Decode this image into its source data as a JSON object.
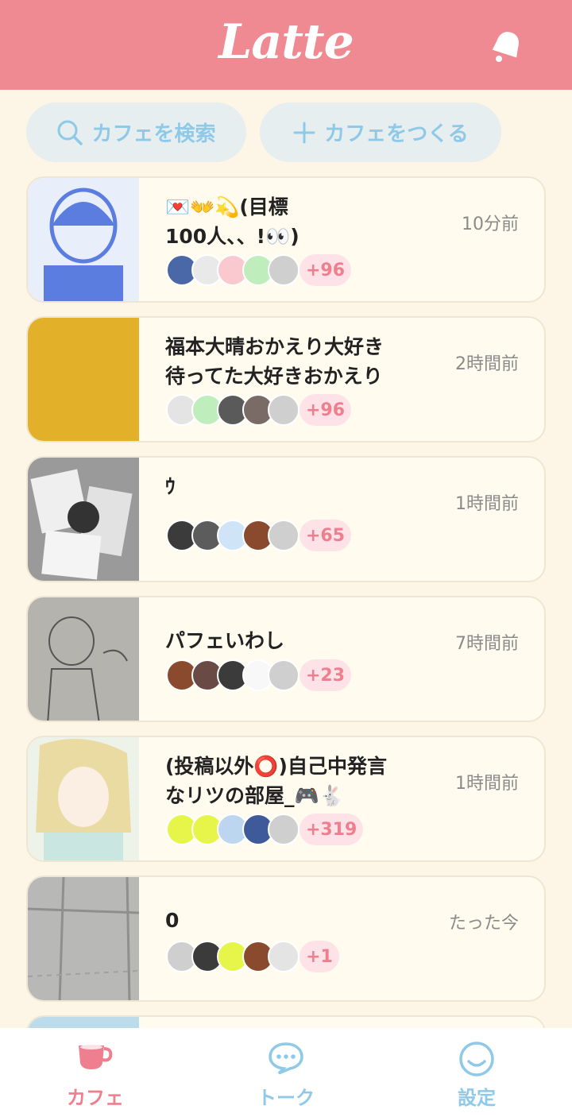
{
  "header": {
    "logo": "Latte",
    "bell_icon": "bell-icon"
  },
  "actions": {
    "search_label": "カフェを検索",
    "create_label": "カフェをつくる"
  },
  "cafes": [
    {
      "title": "💌👐💫(目標\n100人、、!👀)",
      "time": "10分前",
      "more": "+96",
      "thumb": "#5b7de0"
    },
    {
      "title": "福本大晴おかえり大好き\n待ってた大好きおかえり",
      "time": "2時間前",
      "more": "+96",
      "thumb": "#e3b02a"
    },
    {
      "title": "ｳ",
      "time": "1時間前",
      "more": "+65",
      "thumb": "#6a6a6a"
    },
    {
      "title": "パフェいわし",
      "time": "7時間前",
      "more": "+23",
      "thumb": "#b5b3ad"
    },
    {
      "title": "(投稿以外⭕)自己中発言\nなリツの部屋_🎮🐇",
      "time": "1時間前",
      "more": "+319",
      "thumb": "#e9dba2"
    },
    {
      "title": "  0",
      "time": "たった今",
      "more": "+1",
      "thumb": "#b8b8b6"
    }
  ],
  "nav": {
    "cafe": "カフェ",
    "talk": "トーク",
    "settings": "設定"
  },
  "colors": {
    "header": "#f08a92",
    "accent_blue": "#8fc9e8",
    "badge_pink": "#ef7f8e",
    "background": "#fdf6e6"
  }
}
